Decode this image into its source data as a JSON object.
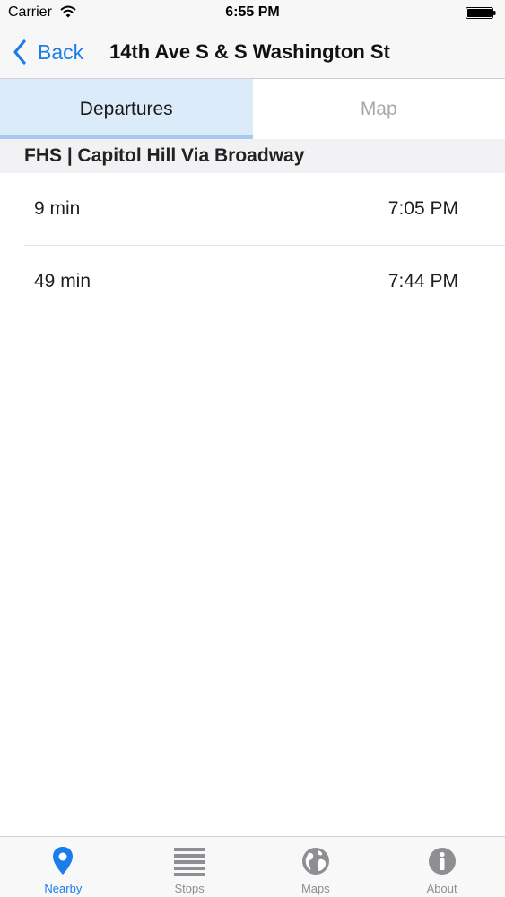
{
  "status_bar": {
    "carrier": "Carrier",
    "time": "6:55 PM",
    "icons": [
      "wifi-icon",
      "battery-icon"
    ]
  },
  "nav_bar": {
    "back_label": "Back",
    "title": "14th Ave S & S Washington St"
  },
  "tabs": [
    {
      "label": "Departures",
      "active": true
    },
    {
      "label": "Map",
      "active": false
    }
  ],
  "section": {
    "title": "FHS | Capitol Hill Via Broadway"
  },
  "departures": [
    {
      "minutes": "9 min",
      "time": "7:05 PM"
    },
    {
      "minutes": "49 min",
      "time": "7:44 PM"
    }
  ],
  "tab_bar": {
    "items": [
      {
        "label": "Nearby",
        "icon": "location-pin-icon",
        "active": true
      },
      {
        "label": "Stops",
        "icon": "list-icon",
        "active": false
      },
      {
        "label": "Maps",
        "icon": "globe-icon",
        "active": false
      },
      {
        "label": "About",
        "icon": "info-icon",
        "active": false
      }
    ]
  },
  "colors": {
    "accent": "#1a7dea",
    "tab_active_bg": "#dcebf9",
    "inactive_gray": "#8e8e93"
  }
}
